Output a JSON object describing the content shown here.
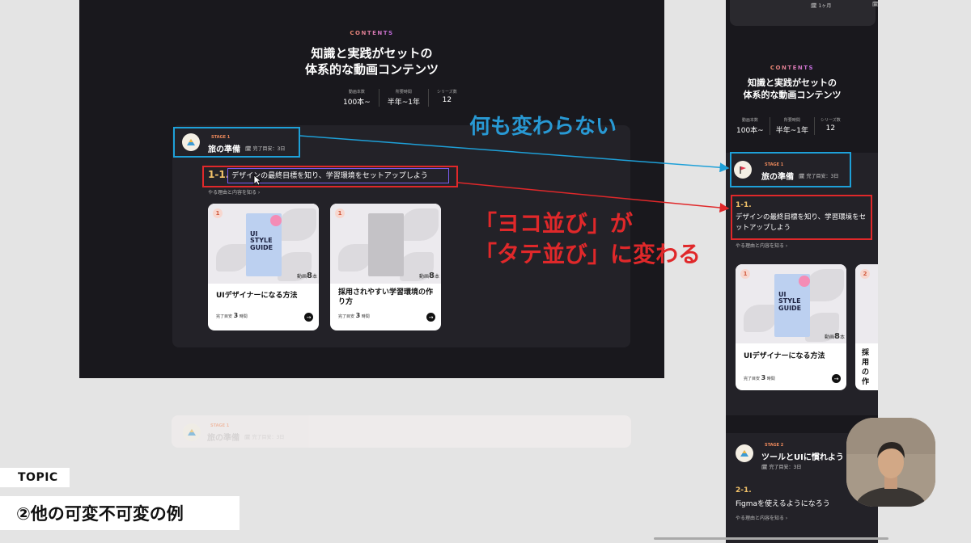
{
  "desktop": {
    "contents_label": "CONTENTS",
    "heading_line1": "知識と実践がセットの",
    "heading_line2": "体系的な動画コンテンツ",
    "stats": [
      {
        "label": "動画本数",
        "value": "100本~"
      },
      {
        "label": "所要時間",
        "value": "半年~1年"
      },
      {
        "label": "シリーズ数",
        "value": "12"
      }
    ],
    "stage": {
      "small": "STAGE 1",
      "title": "旅の準備",
      "time": "完了目安：3日"
    },
    "chapter": {
      "num": "1-1.",
      "title": "デザインの最終目標を知り、学習環境をセットアップしよう",
      "reason": "やる理由と内容を知る ›"
    },
    "cards": [
      {
        "num": "1",
        "book": "UI STYLE GUIDE",
        "count_num": "8",
        "count_unit": "本",
        "count_prefix": "動画",
        "title": "UIデザイナーになる方法",
        "meta_label": "完了目安",
        "meta_value": "3",
        "meta_unit": "時間"
      },
      {
        "num": "1",
        "count_num": "8",
        "count_unit": "本",
        "count_prefix": "動画",
        "title": "採用されやすい学習環境の作り方",
        "meta_label": "完了目安",
        "meta_value": "3",
        "meta_unit": "時間"
      }
    ],
    "faded_stage": {
      "small": "STAGE 1",
      "title": "旅の準備",
      "time": "完了目安：3日"
    }
  },
  "mobile": {
    "top_text": "1ヶ月",
    "contents_label": "CONTENTS",
    "heading_line1": "知識と実践がセットの",
    "heading_line2": "体系的な動画コンテンツ",
    "stats": [
      {
        "label": "動画本数",
        "value": "100本~"
      },
      {
        "label": "所要時間",
        "value": "半年~1年"
      },
      {
        "label": "シリーズ数",
        "value": "12"
      }
    ],
    "stage": {
      "small": "STAGE 1",
      "title": "旅の準備",
      "time": "完了目安：3日"
    },
    "chapter": {
      "num": "1-1.",
      "title": "デザインの最終目標を知り、学習環境をセットアップしよう",
      "reason": "やる理由と内容を知る ›"
    },
    "cards": [
      {
        "num": "1",
        "book": "UI STYLE GUIDE",
        "count_num": "8",
        "count_unit": "本",
        "count_prefix": "動画",
        "title": "UIデザイナーになる方法",
        "meta_label": "完了目安",
        "meta_value": "3",
        "meta_unit": "時間"
      },
      {
        "num": "2",
        "title": "採用の作"
      }
    ],
    "stage2": {
      "small": "STAGE 2",
      "title": "ツールとUIに慣れよう",
      "time": "完了目安：3日"
    },
    "chapter2": {
      "num": "2-1.",
      "title": "Figmaを使えるようになろう",
      "reason": "やる理由と内容を知る ›"
    }
  },
  "annotations": {
    "blue": "何も変わらない",
    "red_line1": "「ヨコ並び」が",
    "red_line2": "「タテ並び」に変わる"
  },
  "topic": {
    "badge": "TOPIC",
    "title": "②他の可変不可変の例"
  },
  "colors": {
    "blue": "#1ea0d8",
    "red": "#e0282a",
    "panel": "#19181d",
    "accent": "#f3c36a"
  }
}
